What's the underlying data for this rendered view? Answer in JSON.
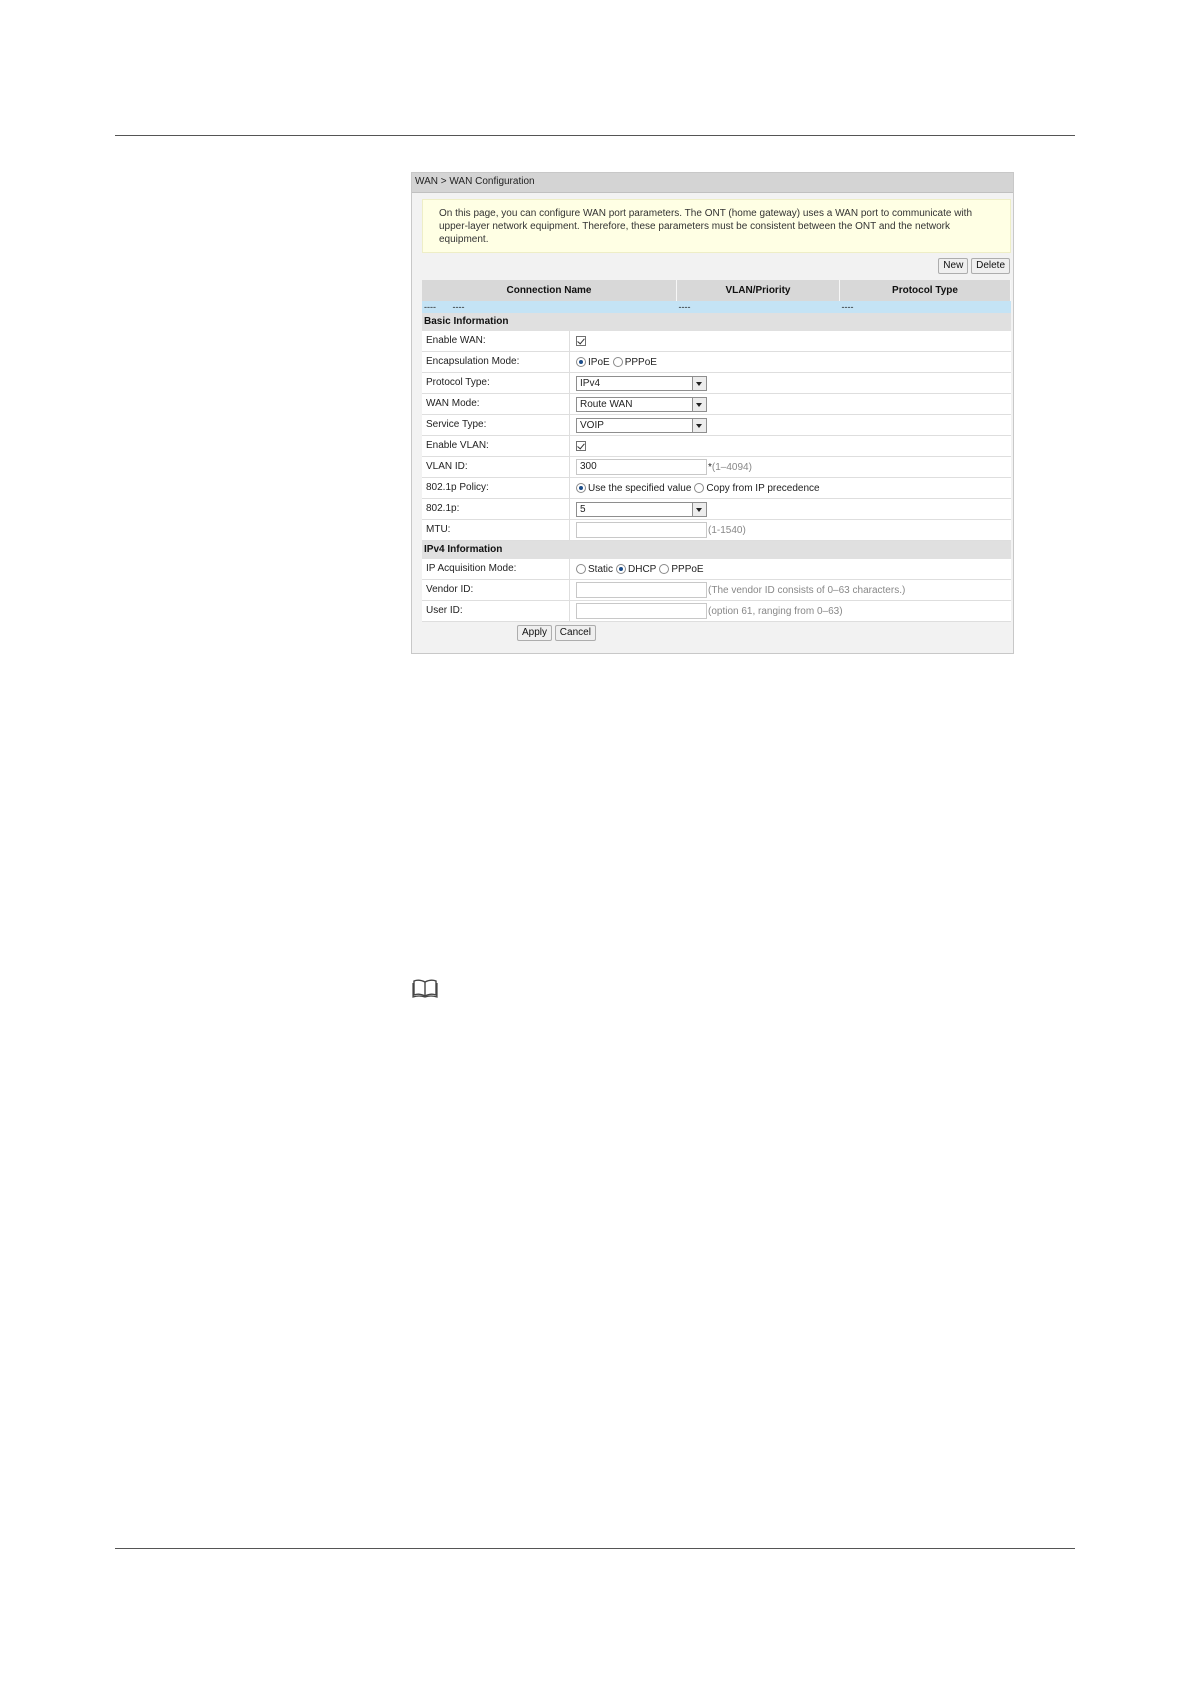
{
  "breadcrumb": "WAN > WAN Configuration",
  "intro": "On this page, you can configure WAN port parameters. The ONT (home gateway) uses a WAN port to communicate with upper-layer network equipment. Therefore, these parameters must be consistent between the ONT and the network equipment.",
  "toolbar": {
    "new_label": "New",
    "delete_label": "Delete"
  },
  "table": {
    "headers": [
      "Connection Name",
      "VLAN/Priority",
      "Protocol Type"
    ],
    "row": [
      "----",
      "----",
      "----",
      "----"
    ]
  },
  "basic": {
    "title": "Basic Information",
    "enable_wan": {
      "label": "Enable WAN:",
      "checked": true
    },
    "encap": {
      "label": "Encapsulation Mode:",
      "opt1": "IPoE",
      "opt2": "PPPoE",
      "selected": "IPoE"
    },
    "protocol": {
      "label": "Protocol Type:",
      "value": "IPv4"
    },
    "wan_mode": {
      "label": "WAN Mode:",
      "value": "Route WAN"
    },
    "service": {
      "label": "Service Type:",
      "value": "VOIP"
    },
    "enable_vlan": {
      "label": "Enable VLAN:",
      "checked": true
    },
    "vlan_id": {
      "label": "VLAN ID:",
      "value": "300",
      "req": "*",
      "hint": "(1–4094)"
    },
    "policy": {
      "label": "802.1p Policy:",
      "opt1": "Use the specified value",
      "opt2": "Copy from IP precedence",
      "selected": "Use the specified value"
    },
    "p8021": {
      "label": "802.1p:",
      "value": "5"
    },
    "mtu": {
      "label": "MTU:",
      "value": "",
      "hint": "(1-1540)"
    }
  },
  "ipv4": {
    "title": "IPv4 Information",
    "acq": {
      "label": "IP Acquisition Mode:",
      "opt1": "Static",
      "opt2": "DHCP",
      "opt3": "PPPoE",
      "selected": "DHCP"
    },
    "vendor": {
      "label": "Vendor ID:",
      "value": "",
      "hint": "(The vendor ID consists of 0–63 characters.)"
    },
    "user": {
      "label": "User ID:",
      "value": "",
      "hint": "(option 61, ranging from 0–63)"
    }
  },
  "actions": {
    "apply_label": "Apply",
    "cancel_label": "Cancel"
  },
  "icons": {
    "note": "book-icon"
  }
}
